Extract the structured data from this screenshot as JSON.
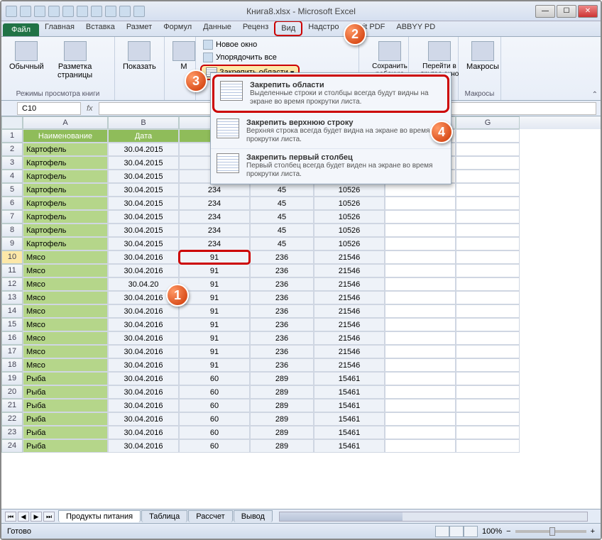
{
  "title": "Книга8.xlsx - Microsoft Excel",
  "tabs": {
    "file": "Файл",
    "list": [
      "Главная",
      "Вставка",
      "Размет",
      "Формул",
      "Данные",
      "Реценз",
      "Вид",
      "Надстро",
      "Foxit PDF",
      "ABBYY PD"
    ],
    "activeIndex": 6
  },
  "ribbon": {
    "normal": "Обычный",
    "pageLayout": "Разметка страницы",
    "viewsGroup": "Режимы просмотра книги",
    "show": "Показать",
    "zoom": "М",
    "newWindow": "Новое окно",
    "arrangeAll": "Упорядочить все",
    "freezePanes": "Закрепить области",
    "saveWorkspace": "Сохранить рабочую область",
    "switchWindows": "Перейти в другое окно",
    "macros": "Макросы",
    "macrosGroup": "Макросы"
  },
  "dropdown": {
    "item1": {
      "title": "Закрепить области",
      "desc": "Выделенные строки и столбцы всегда будут видны на экране во время прокрутки листа."
    },
    "item2": {
      "title": "Закрепить верхнюю строку",
      "desc": "Верхняя строка всегда будет видна на экране во время прокрутки листа."
    },
    "item3": {
      "title": "Закрепить первый столбец",
      "desc": "Первый столбец всегда будет виден на экране во время прокрутки листа."
    }
  },
  "nameBox": "C10",
  "columns": [
    "A",
    "B",
    "C",
    "D",
    "E",
    "F",
    "G"
  ],
  "headers": {
    "a": "Наименование",
    "b": "Дата",
    "c": "К",
    "d": "",
    "e": ""
  },
  "rows": [
    {
      "n": 1,
      "hdr": true
    },
    {
      "n": 2,
      "a": "Картофель",
      "b": "30.04.2015",
      "c": "",
      "d": "",
      "e": ""
    },
    {
      "n": 3,
      "a": "Картофель",
      "b": "30.04.2015",
      "c": "",
      "d": "",
      "e": ""
    },
    {
      "n": 4,
      "a": "Картофель",
      "b": "30.04.2015",
      "c": "",
      "d": "",
      "e": ""
    },
    {
      "n": 5,
      "a": "Картофель",
      "b": "30.04.2015",
      "c": "234",
      "d": "45",
      "e": "10526"
    },
    {
      "n": 6,
      "a": "Картофель",
      "b": "30.04.2015",
      "c": "234",
      "d": "45",
      "e": "10526"
    },
    {
      "n": 7,
      "a": "Картофель",
      "b": "30.04.2015",
      "c": "234",
      "d": "45",
      "e": "10526"
    },
    {
      "n": 8,
      "a": "Картофель",
      "b": "30.04.2015",
      "c": "234",
      "d": "45",
      "e": "10526"
    },
    {
      "n": 9,
      "a": "Картофель",
      "b": "30.04.2015",
      "c": "234",
      "d": "45",
      "e": "10526"
    },
    {
      "n": 10,
      "a": "Мясо",
      "b": "30.04.2016",
      "c": "91",
      "d": "236",
      "e": "21546",
      "sel": true
    },
    {
      "n": 11,
      "a": "Мясо",
      "b": "30.04.2016",
      "c": "91",
      "d": "236",
      "e": "21546"
    },
    {
      "n": 12,
      "a": "Мясо",
      "b": "30.04.20",
      "c": "91",
      "d": "236",
      "e": "21546"
    },
    {
      "n": 13,
      "a": "Мясо",
      "b": "30.04.2016",
      "c": "91",
      "d": "236",
      "e": "21546"
    },
    {
      "n": 14,
      "a": "Мясо",
      "b": "30.04.2016",
      "c": "91",
      "d": "236",
      "e": "21546"
    },
    {
      "n": 15,
      "a": "Мясо",
      "b": "30.04.2016",
      "c": "91",
      "d": "236",
      "e": "21546"
    },
    {
      "n": 16,
      "a": "Мясо",
      "b": "30.04.2016",
      "c": "91",
      "d": "236",
      "e": "21546"
    },
    {
      "n": 17,
      "a": "Мясо",
      "b": "30.04.2016",
      "c": "91",
      "d": "236",
      "e": "21546"
    },
    {
      "n": 18,
      "a": "Мясо",
      "b": "30.04.2016",
      "c": "91",
      "d": "236",
      "e": "21546"
    },
    {
      "n": 19,
      "a": "Рыба",
      "b": "30.04.2016",
      "c": "60",
      "d": "289",
      "e": "15461"
    },
    {
      "n": 20,
      "a": "Рыба",
      "b": "30.04.2016",
      "c": "60",
      "d": "289",
      "e": "15461"
    },
    {
      "n": 21,
      "a": "Рыба",
      "b": "30.04.2016",
      "c": "60",
      "d": "289",
      "e": "15461"
    },
    {
      "n": 22,
      "a": "Рыба",
      "b": "30.04.2016",
      "c": "60",
      "d": "289",
      "e": "15461"
    },
    {
      "n": 23,
      "a": "Рыба",
      "b": "30.04.2016",
      "c": "60",
      "d": "289",
      "e": "15461"
    },
    {
      "n": 24,
      "a": "Рыба",
      "b": "30.04.2016",
      "c": "60",
      "d": "289",
      "e": "15461"
    }
  ],
  "sheets": [
    "Продукты питания",
    "Таблица",
    "Рассчет",
    "Вывод"
  ],
  "status": {
    "ready": "Готово",
    "zoom": "100%"
  },
  "callouts": {
    "c1": "1",
    "c2": "2",
    "c3": "3",
    "c4": "4"
  }
}
